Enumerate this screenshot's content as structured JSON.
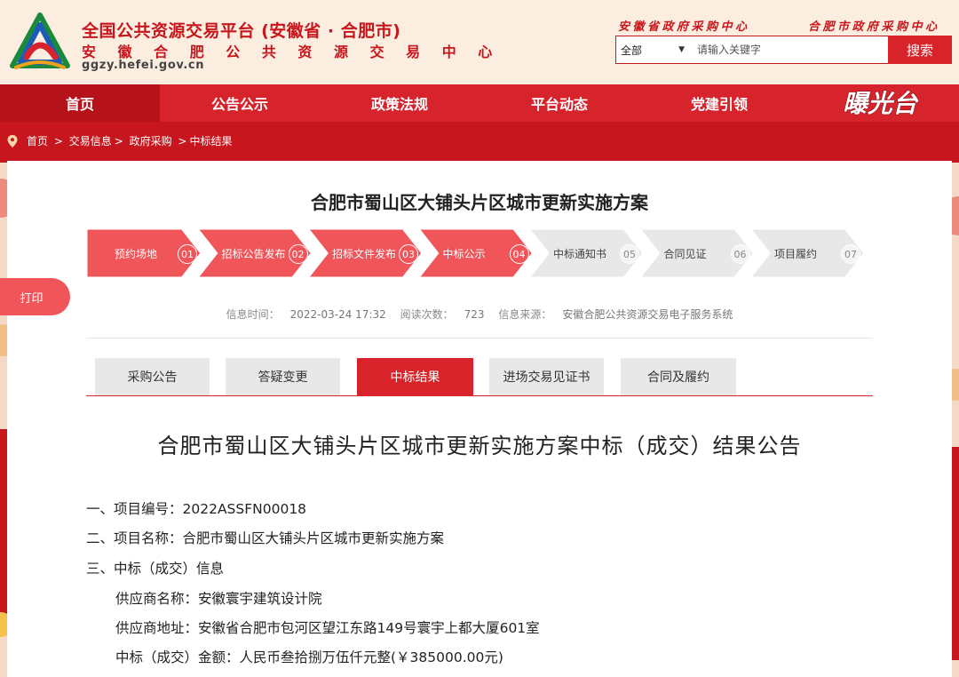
{
  "header": {
    "title": "全国公共资源交易平台 (安徽省 · 合肥市)",
    "subtitle": "安 徽 合 肥 公 共 资 源 交 易 中 心",
    "domain": "ggzy.hefei.gov.cn",
    "ext_links": [
      "安徽省政府采购中心",
      "合肥市政府采购中心"
    ],
    "search": {
      "type": "全部",
      "placeholder": "请输入关键字",
      "button": "搜索"
    }
  },
  "nav": {
    "items": [
      "首页",
      "公告公示",
      "政策法规",
      "平台动态",
      "党建引领"
    ],
    "logo_text": "曝光台"
  },
  "breadcrumb": [
    "首页",
    "交易信息",
    "政府采购",
    "中标结果"
  ],
  "project_title": "合肥市蜀山区大铺头片区城市更新实施方案",
  "steps": [
    {
      "label": "预约场地",
      "num": "01",
      "done": true
    },
    {
      "label": "招标公告发布",
      "num": "02",
      "done": true
    },
    {
      "label": "招标文件发布",
      "num": "03",
      "done": true
    },
    {
      "label": "中标公示",
      "num": "04",
      "done": true
    },
    {
      "label": "中标通知书",
      "num": "05",
      "done": false
    },
    {
      "label": "合同见证",
      "num": "06",
      "done": false
    },
    {
      "label": "项目履约",
      "num": "07",
      "done": false
    }
  ],
  "print_label": "打印",
  "meta": {
    "time_label": "信息时间：",
    "time": "2022-03-24 17:32",
    "reads_label": "阅读次数：",
    "reads": "723",
    "source_label": "信息来源：",
    "source": "安徽合肥公共资源交易电子服务系统"
  },
  "doc_tabs": [
    {
      "label": "采购公告",
      "active": false
    },
    {
      "label": "答疑变更",
      "active": false
    },
    {
      "label": "中标结果",
      "active": true
    },
    {
      "label": "进场交易见证书",
      "active": false
    },
    {
      "label": "合同及履约",
      "active": false
    }
  ],
  "announcement": {
    "title": "合肥市蜀山区大铺头片区城市更新实施方案中标（成交）结果公告",
    "lines": [
      "一、项目编号：2022ASSFN00018",
      "二、项目名称：合肥市蜀山区大铺头片区城市更新实施方案",
      "三、中标（成交）信息",
      "供应商名称：安徽寰宇建筑设计院",
      "供应商地址：安徽省合肥市包河区望江东路149号寰宇上都大厦601室",
      "中标（成交）金额：人民币叁拾捌万伍仟元整(￥385000.00元)"
    ]
  },
  "colors": {
    "brand_red": "#d7232c",
    "step_done": "#f0555a",
    "step_todo": "#e8e8e8"
  }
}
